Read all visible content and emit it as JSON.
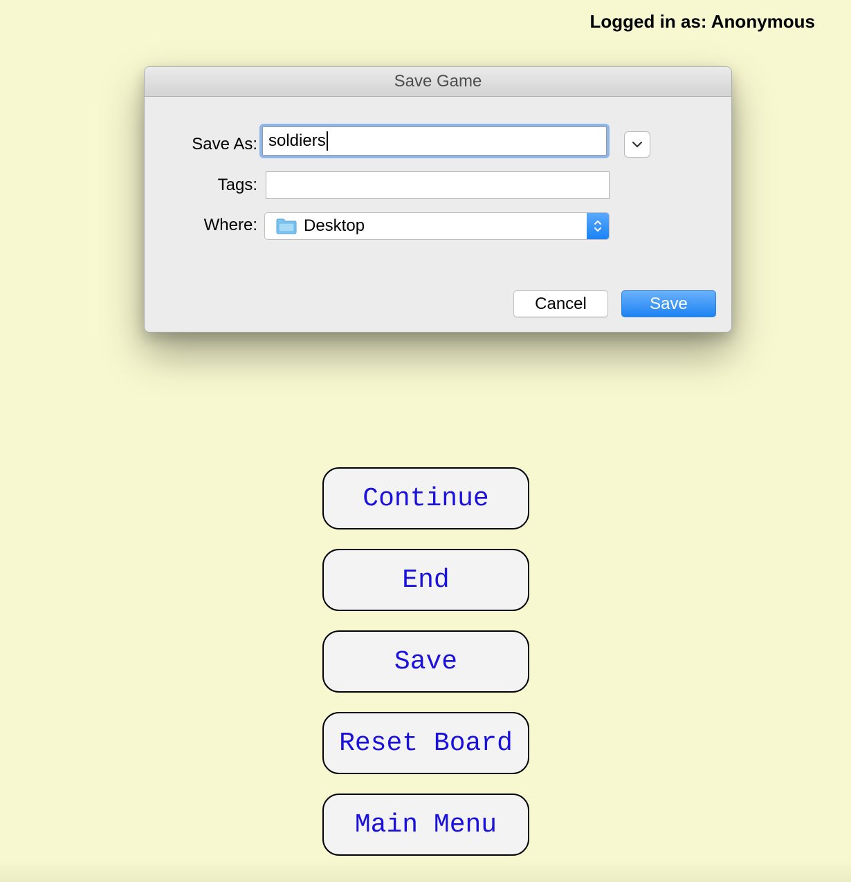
{
  "header": {
    "user_status": "Logged in as: Anonymous"
  },
  "dialog": {
    "title": "Save Game",
    "save_as_label": "Save As:",
    "save_as_value": "soldiers",
    "tags_label": "Tags:",
    "tags_value": "",
    "where_label": "Where:",
    "where_value": "Desktop",
    "cancel_label": "Cancel",
    "save_label": "Save",
    "icons": {
      "expand": "chevron-down-icon",
      "folder": "folder-icon",
      "stepper": "up-down-arrows-icon"
    },
    "colors": {
      "accent": "#1d83f3",
      "focus_ring": "#8fb6ea"
    }
  },
  "menu": {
    "buttons": [
      {
        "label": "Continue"
      },
      {
        "label": "End"
      },
      {
        "label": "Save"
      },
      {
        "label": "Reset Board"
      },
      {
        "label": "Main Menu"
      }
    ],
    "colors": {
      "text": "#1a10e0",
      "background": "#f8f8d0"
    }
  }
}
